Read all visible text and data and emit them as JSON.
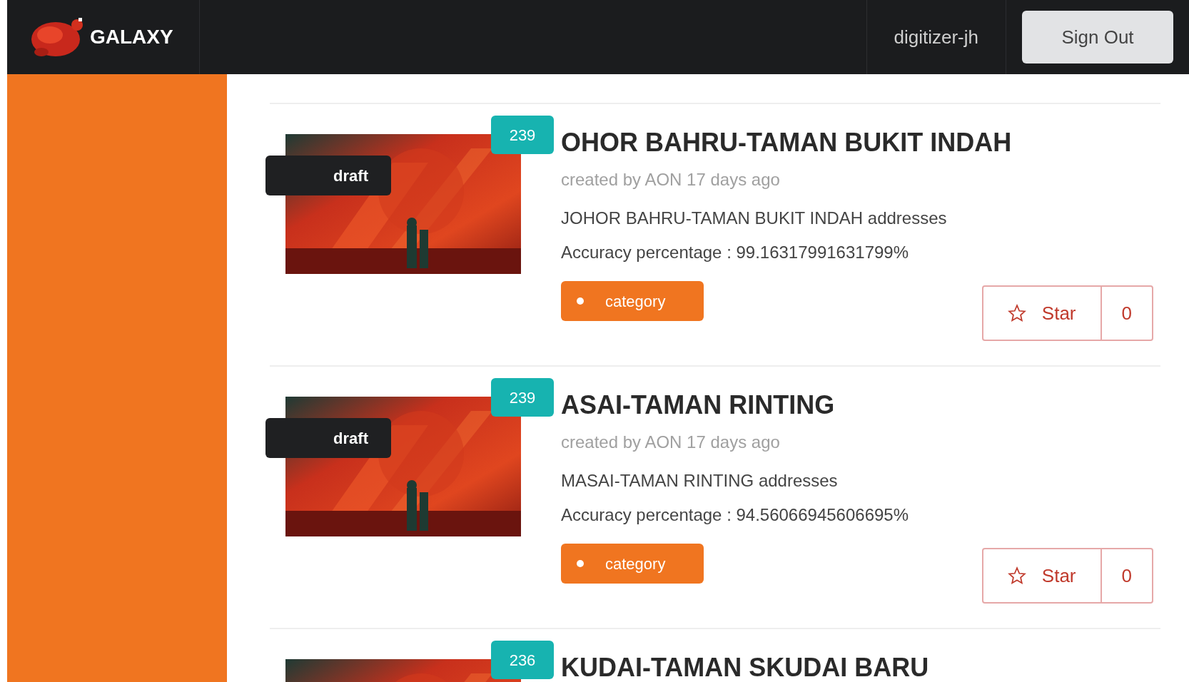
{
  "header": {
    "logo_text": "GALAXY",
    "username": "digitizer-jh",
    "sign_out": "Sign Out"
  },
  "items": [
    {
      "count": "239",
      "status": "draft",
      "title": "OHOR BAHRU-TAMAN BUKIT INDAH",
      "author": "created by AON 17 days ago",
      "description": "JOHOR BAHRU-TAMAN BUKIT INDAH addresses",
      "accuracy": "Accuracy percentage : 99.16317991631799%",
      "tag": "category",
      "star_label": "Star",
      "star_count": "0"
    },
    {
      "count": "239",
      "status": "draft",
      "title": "ASAI-TAMAN RINTING",
      "author": "created by AON 17 days ago",
      "description": "MASAI-TAMAN RINTING addresses",
      "accuracy": "Accuracy percentage : 94.56066945606695%",
      "tag": "category",
      "star_label": "Star",
      "star_count": "0"
    },
    {
      "count": "236",
      "title": "KUDAI-TAMAN SKUDAI BARU"
    }
  ]
}
